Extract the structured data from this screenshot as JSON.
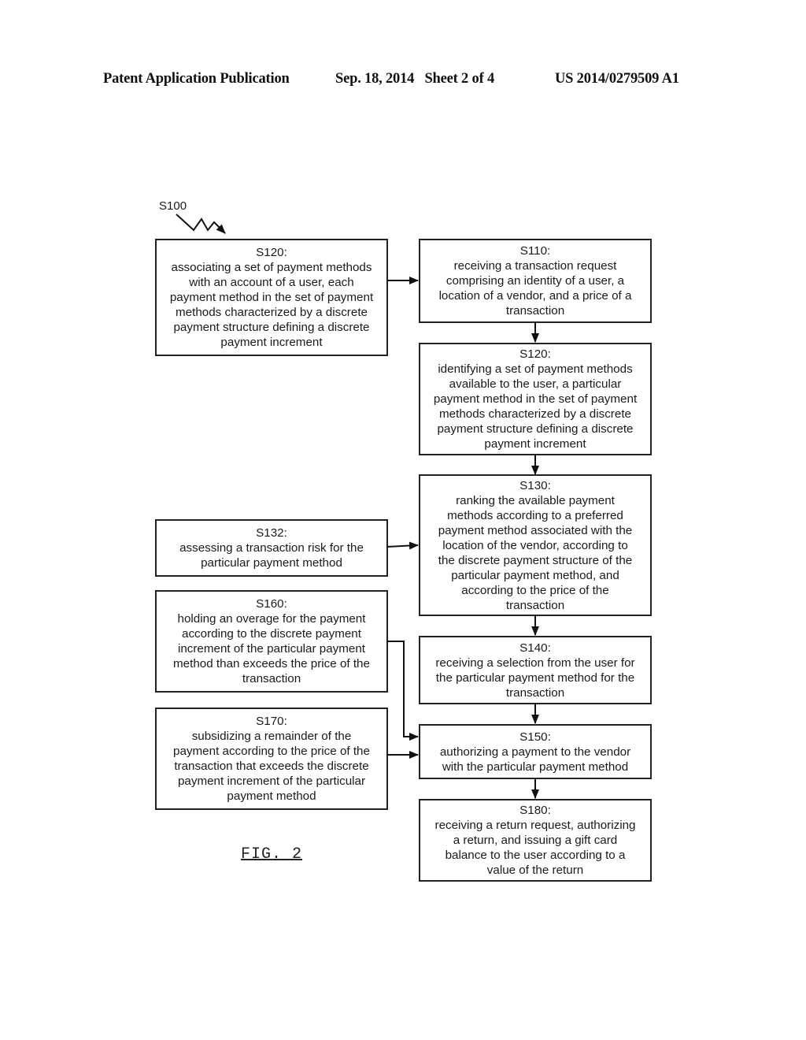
{
  "header": {
    "publication": "Patent Application Publication",
    "date_sheet": "Sep. 18, 2014   Sheet 2 of 4",
    "number": "US 2014/0279509 A1"
  },
  "diagram": {
    "method_label": "S100",
    "figure_label": "FIG. 2",
    "nodes": {
      "s120a": {
        "step": "S120:",
        "text": "associating a set of payment methods\nwith an account of a user, each\npayment method in the set of payment\nmethods characterized by a discrete\npayment structure defining a discrete\npayment increment"
      },
      "s110": {
        "step": "S110:",
        "text": "receiving a transaction request\ncomprising an identity of a user, a\nlocation of a vendor, and a price of a\ntransaction"
      },
      "s120b": {
        "step": "S120:",
        "text": "identifying a set of payment methods\navailable to the user, a particular\npayment method in the set of payment\nmethods characterized by a discrete\npayment structure defining a discrete\npayment increment"
      },
      "s130": {
        "step": "S130:",
        "text": "ranking the available payment\nmethods according to a preferred\npayment method associated with the\nlocation of the vendor, according to\nthe discrete payment structure of the\nparticular payment method, and\naccording to the price of the\ntransaction"
      },
      "s132": {
        "step": "S132:",
        "text": "assessing a transaction risk for the\nparticular payment method"
      },
      "s140": {
        "step": "S140:",
        "text": "receiving a selection from the user for\nthe particular payment method for the\ntransaction"
      },
      "s160": {
        "step": "S160:",
        "text": "holding an overage for the payment\naccording to the discrete payment\nincrement of the particular payment\nmethod than exceeds the price of the\ntransaction"
      },
      "s150": {
        "step": "S150:",
        "text": "authorizing a payment to the vendor\nwith the particular payment method"
      },
      "s170": {
        "step": "S170:",
        "text": "subsidizing a remainder of the\npayment according to the price of the\ntransaction that exceeds the discrete\npayment increment of the particular\npayment method"
      },
      "s180": {
        "step": "S180:",
        "text": "receiving a return request, authorizing\na return, and issuing a gift card\nbalance to the user according to a\nvalue of the return"
      }
    },
    "edges": [
      {
        "from": "s120a",
        "to": "s110"
      },
      {
        "from": "s110",
        "to": "s120b"
      },
      {
        "from": "s120b",
        "to": "s130"
      },
      {
        "from": "s132",
        "to": "s130"
      },
      {
        "from": "s130",
        "to": "s140"
      },
      {
        "from": "s140",
        "to": "s150"
      },
      {
        "from": "s160",
        "to": "s150"
      },
      {
        "from": "s170",
        "to": "s150"
      },
      {
        "from": "s150",
        "to": "s180"
      }
    ]
  }
}
